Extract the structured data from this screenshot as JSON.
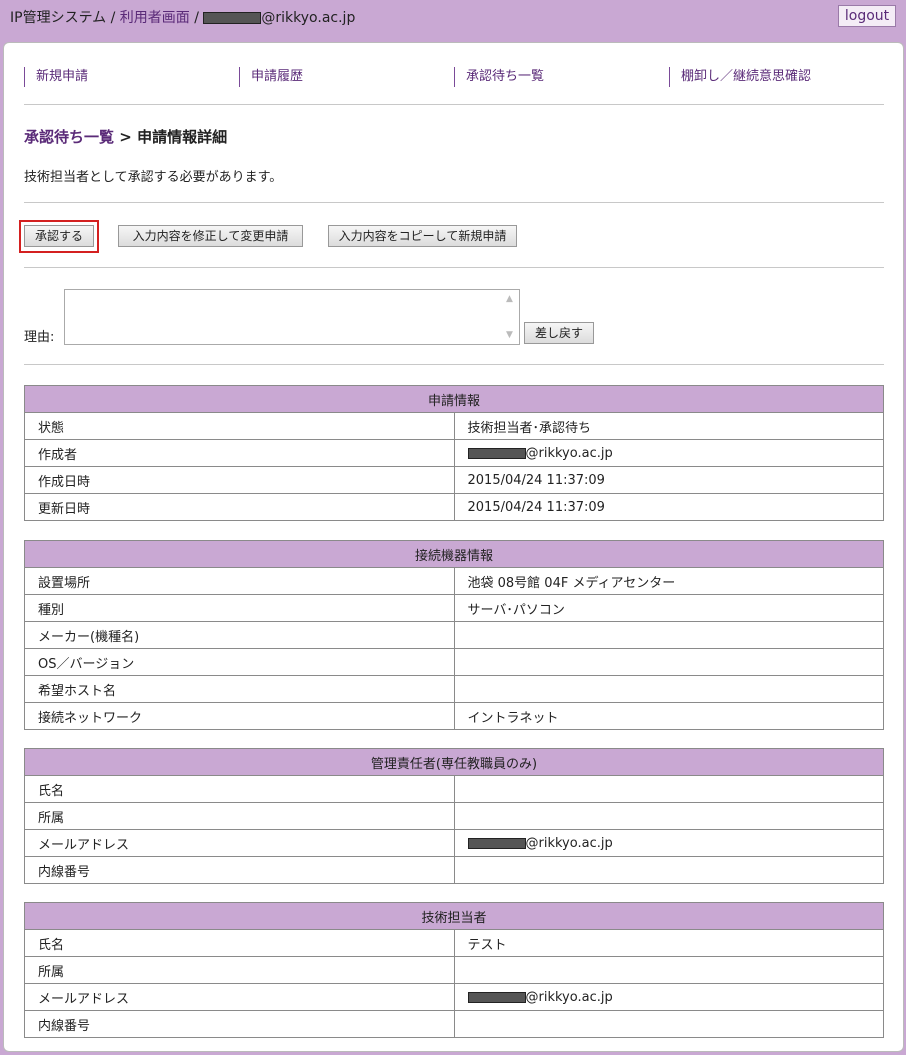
{
  "header": {
    "system": "IP管理システム",
    "separator": "/",
    "user_screen": "利用者画面",
    "email_domain": "@rikkyo.ac.jp",
    "logout": "logout"
  },
  "nav": [
    "新規申請",
    "申請履歴",
    "承認待ち一覧",
    "棚卸し／継続意思確認"
  ],
  "page": {
    "breadcrumb_link": "承認待ち一覧",
    "breadcrumb_sep": ">",
    "title": "申請情報詳細",
    "notice": "技術担当者として承認する必要があります。"
  },
  "actions": {
    "approve": "承認する",
    "modify": "入力内容を修正して変更申請",
    "copy": "入力内容をコピーして新規申請"
  },
  "reason": {
    "label": "理由:",
    "value": "",
    "return_button": "差し戻す"
  },
  "sections": [
    {
      "title": "申請情報",
      "rows": [
        {
          "key": "状態",
          "value": "技術担当者･承認待ち"
        },
        {
          "key": "作成者",
          "value": "@rikkyo.ac.jp",
          "redacted": true
        },
        {
          "key": "作成日時",
          "value": "2015/04/24 11:37:09"
        },
        {
          "key": "更新日時",
          "value": "2015/04/24 11:37:09"
        }
      ]
    },
    {
      "title": "接続機器情報",
      "rows": [
        {
          "key": "設置場所",
          "value": "池袋 08号館 04F メディアセンター"
        },
        {
          "key": "種別",
          "value": "サーバ･パソコン"
        },
        {
          "key": "メーカー(機種名)",
          "value": ""
        },
        {
          "key": "OS／バージョン",
          "value": ""
        },
        {
          "key": "希望ホスト名",
          "value": ""
        },
        {
          "key": "接続ネットワーク",
          "value": "イントラネット"
        }
      ]
    },
    {
      "title": "管理責任者(専任教職員のみ)",
      "rows": [
        {
          "key": "氏名",
          "value": ""
        },
        {
          "key": "所属",
          "value": ""
        },
        {
          "key": "メールアドレス",
          "value": "@rikkyo.ac.jp",
          "redacted": true
        },
        {
          "key": "内線番号",
          "value": ""
        }
      ]
    },
    {
      "title": "技術担当者",
      "rows": [
        {
          "key": "氏名",
          "value": "テスト"
        },
        {
          "key": "所属",
          "value": ""
        },
        {
          "key": "メールアドレス",
          "value": "@rikkyo.ac.jp",
          "redacted": true
        },
        {
          "key": "内線番号",
          "value": ""
        }
      ]
    }
  ]
}
